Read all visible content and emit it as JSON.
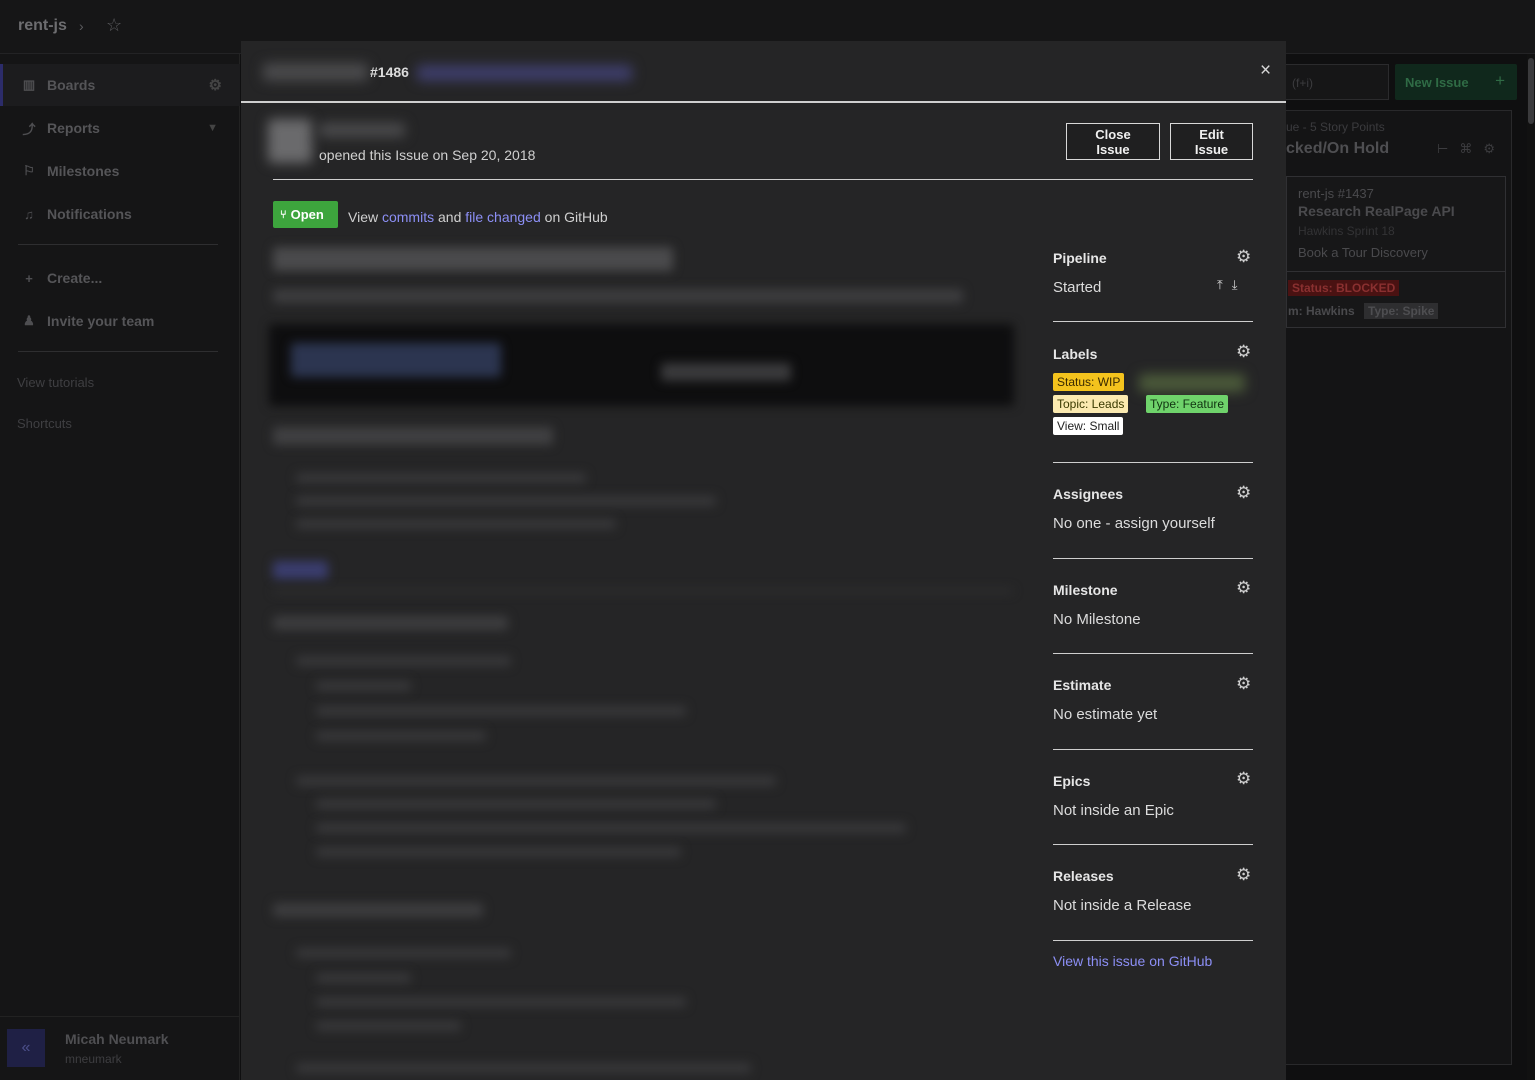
{
  "topbar": {
    "repo": "rent-js",
    "chevron": "›",
    "star": "☆"
  },
  "sidebar": {
    "items": [
      {
        "label": "Boards",
        "icon": "boards-icon",
        "glyph": "▥"
      },
      {
        "label": "Reports",
        "icon": "reports-icon",
        "glyph": "⤴"
      },
      {
        "label": "Milestones",
        "icon": "milestones-icon",
        "glyph": "⚐"
      },
      {
        "label": "Notifications",
        "icon": "bell-icon",
        "glyph": "♫"
      },
      {
        "label": "Create...",
        "icon": "plus-icon",
        "glyph": "+"
      },
      {
        "label": "Invite your team",
        "icon": "person-icon",
        "glyph": "♟"
      }
    ],
    "links": [
      "View tutorials",
      "Shortcuts"
    ],
    "user": {
      "name": "Micah Neumark",
      "handle": "mneumark"
    },
    "collapse": "«"
  },
  "board": {
    "search_placeholder": "(f+i)",
    "new_issue": "New Issue",
    "new_plus": "+",
    "column_sub": "ue - 5 Story Points",
    "column_title": "cked/On Hold",
    "card": {
      "repo_no": "rent-js #1437",
      "title": "Research RealPage API",
      "sprint": "Hawkins Sprint 18",
      "epic": "Book a Tour Discovery",
      "status_tag": "Status: BLOCKED",
      "team": "m: Hawkins",
      "type_tag": "Type: Spike"
    }
  },
  "modal": {
    "issue_number": "#1486",
    "close_glyph": "×",
    "opened_text": "opened this Issue on Sep 20, 2018",
    "close_issue": "Close Issue",
    "edit_issue": "Edit Issue",
    "open_badge": "Open",
    "view": "View",
    "commits": "commits",
    "and": "and",
    "file_changed": "file changed",
    "on_github": "on GitHub"
  },
  "panel": {
    "pipeline": {
      "title": "Pipeline",
      "value": "Started"
    },
    "labels": {
      "title": "Labels",
      "items": [
        {
          "text": "Status: WIP",
          "bg": "#f4c31d",
          "fg": "#3a2a00"
        },
        {
          "text": "Topic: Leads",
          "bg": "#fbeab0",
          "fg": "#3a3a00"
        },
        {
          "text": "Type: Feature",
          "bg": "#6fd36b",
          "fg": "#113311"
        },
        {
          "text": "View: Small",
          "bg": "#ffffff",
          "fg": "#222222"
        }
      ]
    },
    "assignees": {
      "title": "Assignees",
      "value": "No one - assign yourself"
    },
    "milestone": {
      "title": "Milestone",
      "value": "No Milestone"
    },
    "estimate": {
      "title": "Estimate",
      "value": "No estimate yet"
    },
    "epics": {
      "title": "Epics",
      "value": "Not inside an Epic"
    },
    "releases": {
      "title": "Releases",
      "value": "Not inside a Release"
    },
    "github_link": "View this issue on GitHub",
    "gear": "⚙",
    "pipeline_icons": "⤒⤓"
  }
}
